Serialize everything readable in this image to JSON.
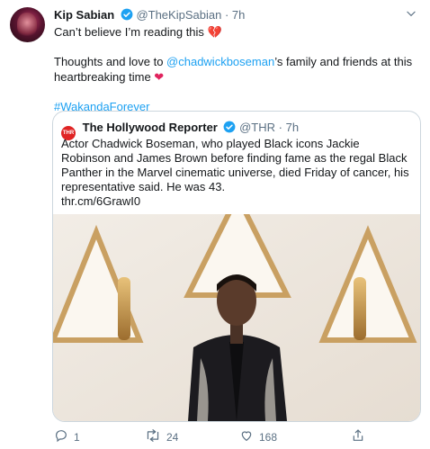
{
  "tweet": {
    "display_name": "Kip Sabian",
    "handle": "@TheKipSabian",
    "separator": "·",
    "time": "7h",
    "line1": "Can’t believe I’m reading this",
    "line2a": "Thoughts and love to ",
    "mention": "@chadwickboseman",
    "line2b": "’s family and friends at this heartbreaking time",
    "hashtag": "#WakandaForever",
    "icons": {
      "broken_heart": "💔",
      "heart": "❤",
      "more": "caret-down-icon"
    }
  },
  "quoted": {
    "logo_text": "THR",
    "display_name": "The Hollywood Reporter",
    "handle": "@THR",
    "separator": "·",
    "time": "7h",
    "text": "Actor Chadwick Boseman, who played Black icons Jackie Robinson and James Brown before finding fame as the regal Black Panther in the Marvel cinematic universe, died Friday of cancer, his representative said. He was 43.",
    "link": "thr.cm/6GrawI0"
  },
  "actions": {
    "replies": "1",
    "retweets": "24",
    "likes": "168"
  },
  "colors": {
    "accent": "#1da1f2",
    "like": "#e0245e",
    "muted": "#5b7083"
  }
}
